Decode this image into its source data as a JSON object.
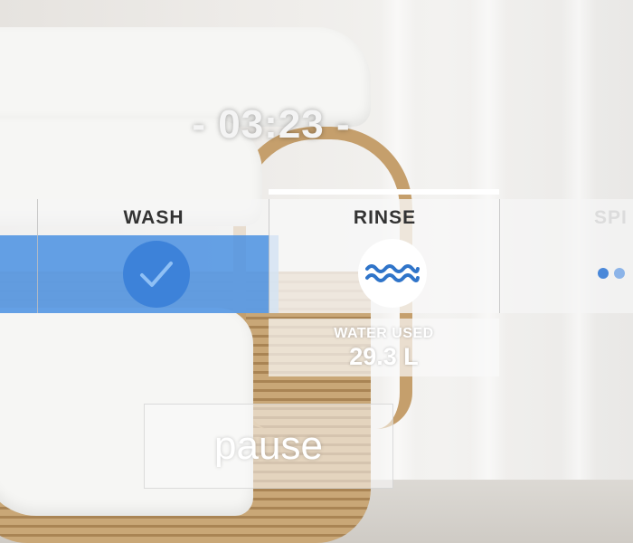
{
  "timer": {
    "text": "- 03:23 -"
  },
  "cycles": {
    "wash": {
      "label": "WASH",
      "status": "complete",
      "icon": "check-icon"
    },
    "rinse": {
      "label": "RINSE",
      "status": "active",
      "icon": "water-wave-icon"
    },
    "spin": {
      "label": "SPI",
      "status": "pending",
      "icon": "dots-icon"
    }
  },
  "water": {
    "label": "WATER USED",
    "value": "29.3 L"
  },
  "controls": {
    "pause_label": "pause"
  },
  "colors": {
    "accent": "#4a90e2",
    "accent_dark": "#3d82d9",
    "wave": "#2f74c9"
  }
}
